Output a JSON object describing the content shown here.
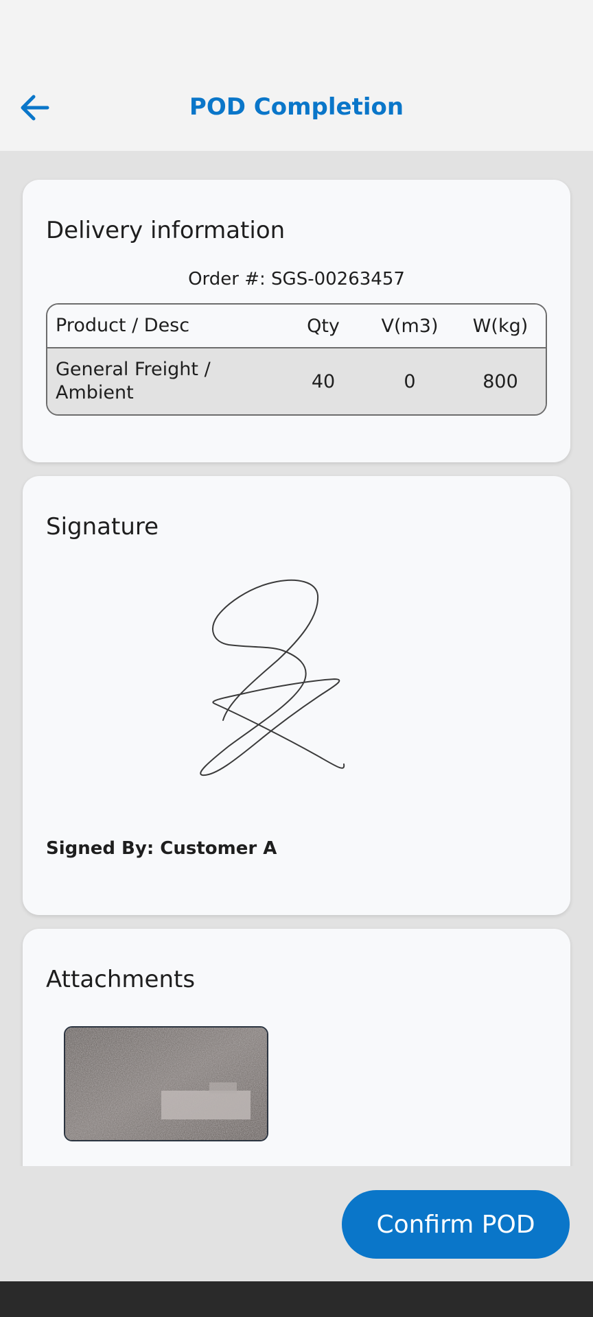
{
  "header": {
    "title": "POD Completion",
    "back_icon": "arrow-left-icon"
  },
  "delivery": {
    "title": "Delivery information",
    "order_label": "Order #:",
    "order_number": "SGS-00263457",
    "columns": [
      "Product / Desc",
      "Qty",
      "V(m3)",
      "W(kg)"
    ],
    "rows": [
      {
        "desc": "General Freight / Ambient",
        "qty": "40",
        "volume": "0",
        "weight": "800"
      }
    ]
  },
  "signature": {
    "title": "Signature",
    "signed_by_label": "Signed By:",
    "signed_by_name": "Customer A"
  },
  "attachments": {
    "title": "Attachments"
  },
  "actions": {
    "confirm_label": "Confirm POD"
  },
  "colors": {
    "accent": "#0a76c9",
    "background": "#e2e2e2",
    "card": "#f8f9fb"
  }
}
